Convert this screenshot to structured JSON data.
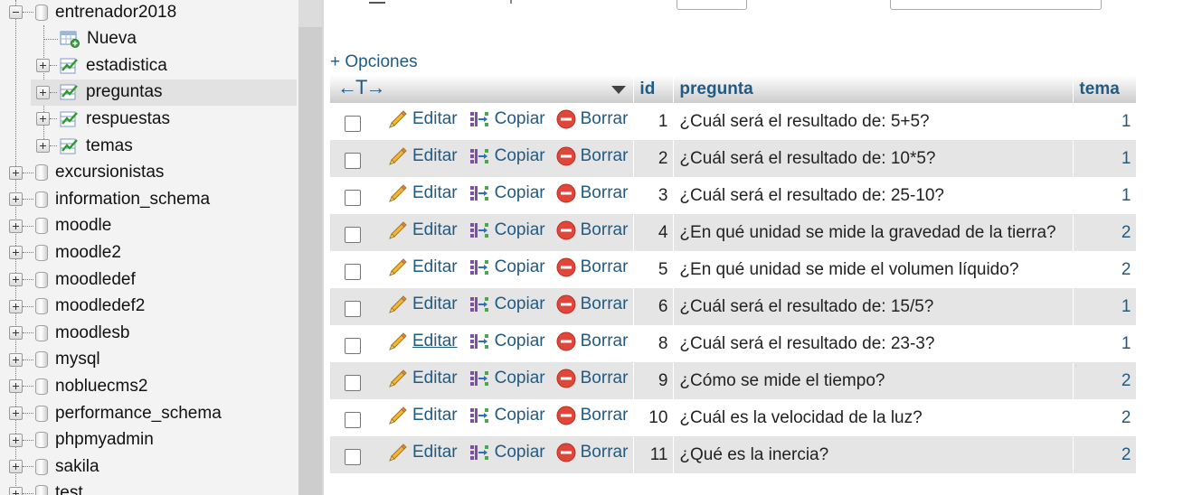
{
  "nav": {
    "databases": [
      {
        "name": "entrenador2018",
        "expanded": true,
        "children": [
          {
            "name": "Nueva",
            "type": "new"
          },
          {
            "name": "estadistica",
            "type": "table"
          },
          {
            "name": "preguntas",
            "type": "table",
            "active": true
          },
          {
            "name": "respuestas",
            "type": "table"
          },
          {
            "name": "temas",
            "type": "table"
          }
        ]
      },
      {
        "name": "excursionistas"
      },
      {
        "name": "information_schema"
      },
      {
        "name": "moodle"
      },
      {
        "name": "moodle2"
      },
      {
        "name": "moodledef"
      },
      {
        "name": "moodledef2"
      },
      {
        "name": "moodlesb"
      },
      {
        "name": "mysql"
      },
      {
        "name": "nobluecms2"
      },
      {
        "name": "performance_schema"
      },
      {
        "name": "phpmyadmin"
      },
      {
        "name": "sakila"
      },
      {
        "name": "test"
      }
    ]
  },
  "options_link": "+ Opciones",
  "arrows_glyph": "←T→",
  "columns": {
    "id": "id",
    "pregunta": "pregunta",
    "tema": "tema"
  },
  "actions": {
    "edit": "Editar",
    "copy": "Copiar",
    "delete": "Borrar"
  },
  "rows": [
    {
      "id": "1",
      "pregunta": "¿Cuál será el resultado de: 5+5?",
      "tema": "1"
    },
    {
      "id": "2",
      "pregunta": "¿Cuál será el resultado de: 10*5?",
      "tema": "1"
    },
    {
      "id": "3",
      "pregunta": "¿Cuál será el resultado de: 25-10?",
      "tema": "1"
    },
    {
      "id": "4",
      "pregunta": "¿En qué unidad se mide la gravedad de la tierra?",
      "tema": "2"
    },
    {
      "id": "5",
      "pregunta": "¿En qué unidad se mide el volumen líquido?",
      "tema": "2"
    },
    {
      "id": "6",
      "pregunta": "¿Cuál será el resultado de: 15/5?",
      "tema": "1"
    },
    {
      "id": "8",
      "pregunta": "¿Cuál será el resultado de: 23-3?",
      "tema": "1",
      "hover_edit": true
    },
    {
      "id": "9",
      "pregunta": "¿Cómo se mide el tiempo?",
      "tema": "2"
    },
    {
      "id": "10",
      "pregunta": "¿Cuál es la velocidad de la luz?",
      "tema": "2"
    },
    {
      "id": "11",
      "pregunta": "¿Qué es la inercia?",
      "tema": "2"
    }
  ],
  "colors": {
    "link": "#235a81",
    "row_alt": "#e5e5e5",
    "nav_bg": "#f3f3f3",
    "delete_icon": "#e0463a"
  }
}
